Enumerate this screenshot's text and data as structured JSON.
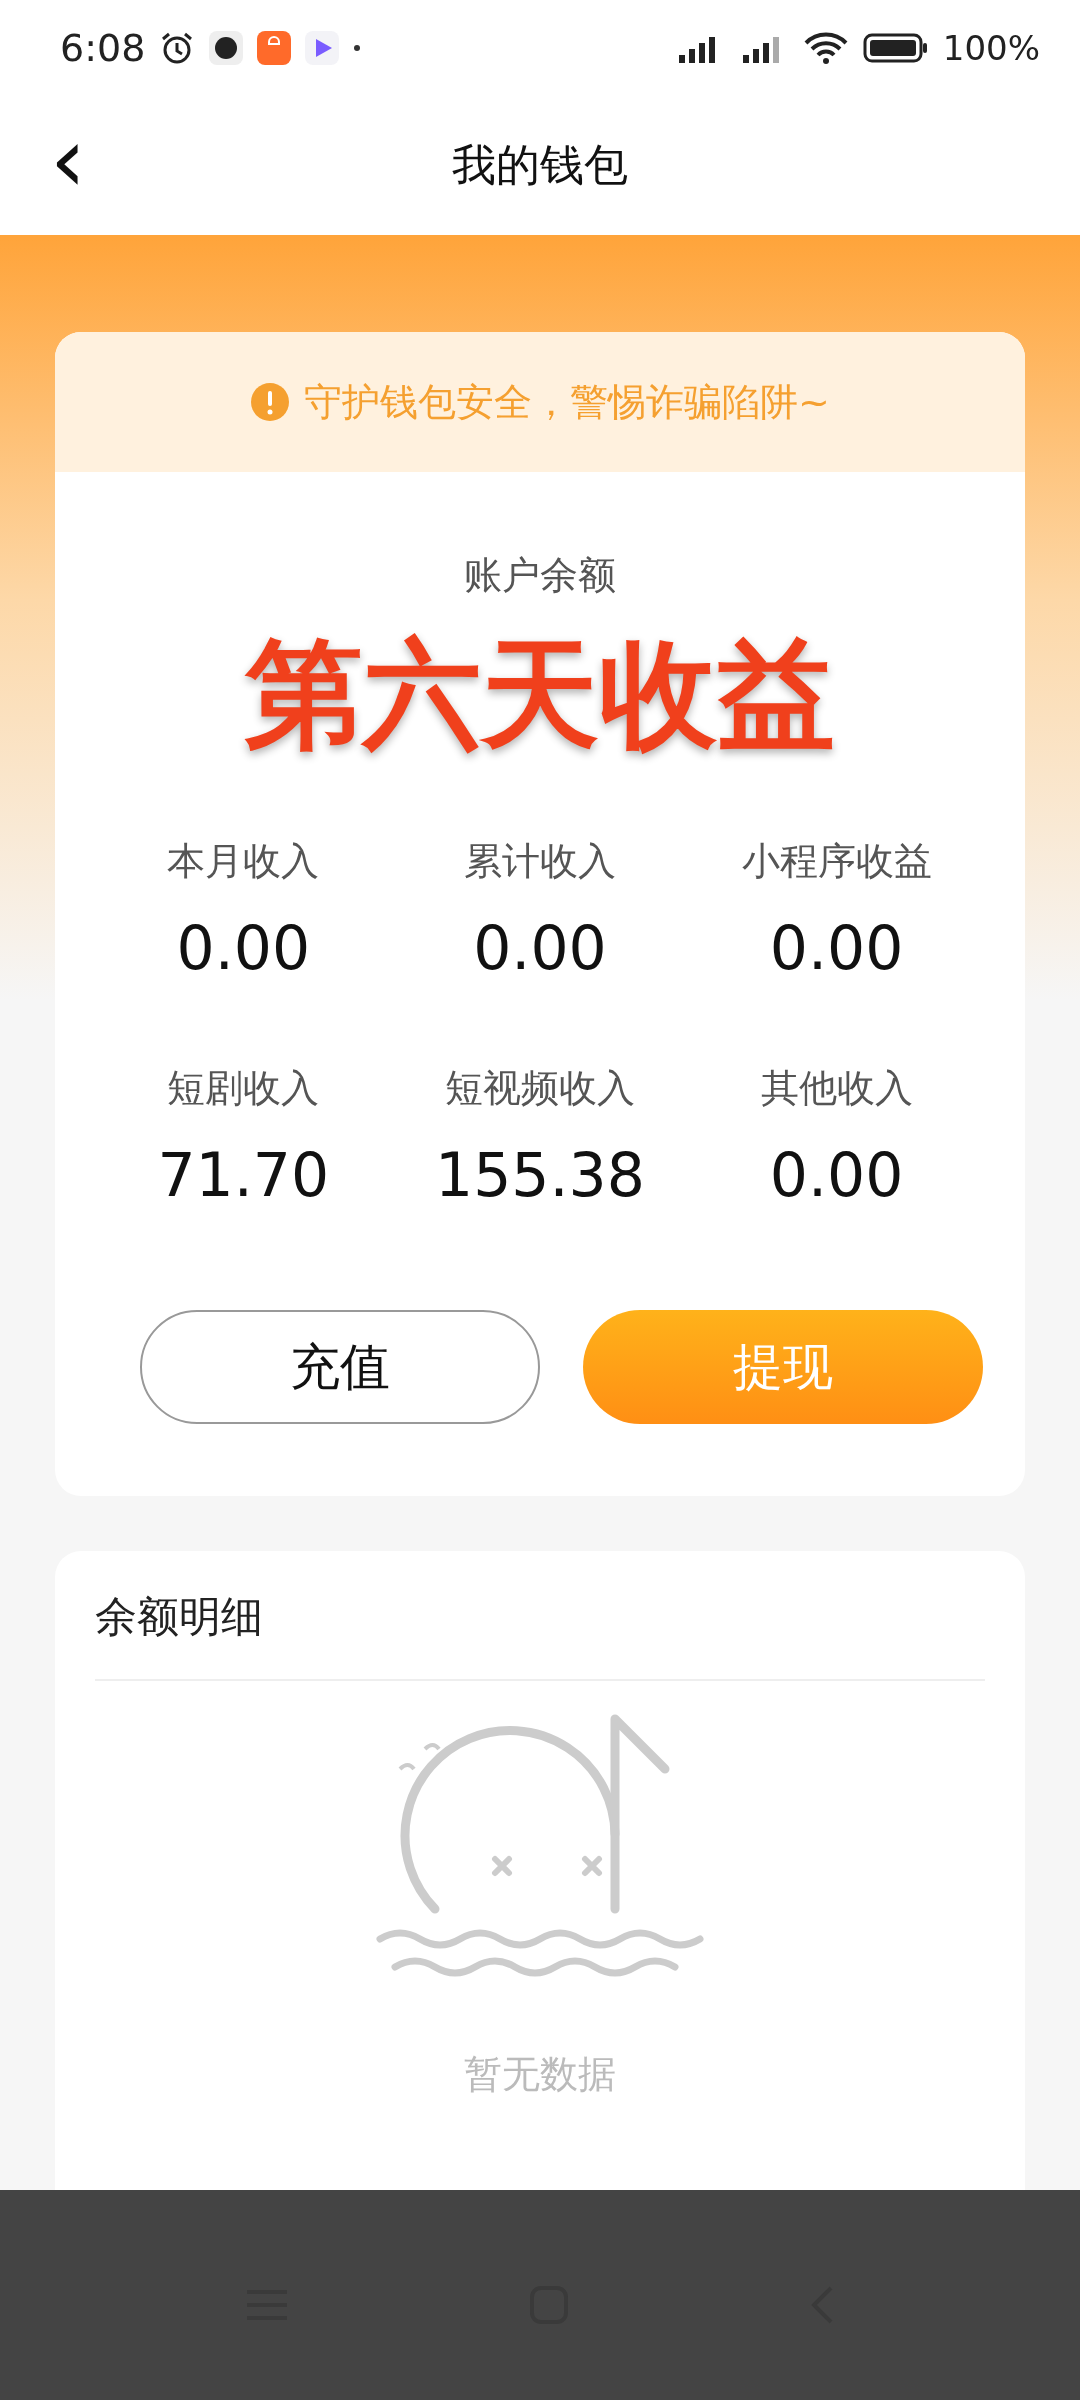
{
  "status_bar": {
    "time": "6:08",
    "battery": "100%"
  },
  "header": {
    "title": "我的钱包",
    "back": "‹"
  },
  "notice": {
    "text": "守护钱包安全，警惕诈骗陷阱~"
  },
  "balance": {
    "label": "账户余额",
    "overlay_caption": "第六天收益"
  },
  "stats": [
    {
      "label": "本月收入",
      "value": "0.00"
    },
    {
      "label": "累计收入",
      "value": "0.00"
    },
    {
      "label": "小程序收益",
      "value": "0.00"
    },
    {
      "label": "短剧收入",
      "value": "71.70"
    },
    {
      "label": "短视频收入",
      "value": "155.38"
    },
    {
      "label": "其他收入",
      "value": "0.00"
    }
  ],
  "buttons": [
    {
      "label": "充值",
      "kind": "outline"
    },
    {
      "label": "提现",
      "kind": "primary"
    }
  ],
  "details": {
    "title": "余额明细",
    "empty_text": "暂无数据"
  }
}
